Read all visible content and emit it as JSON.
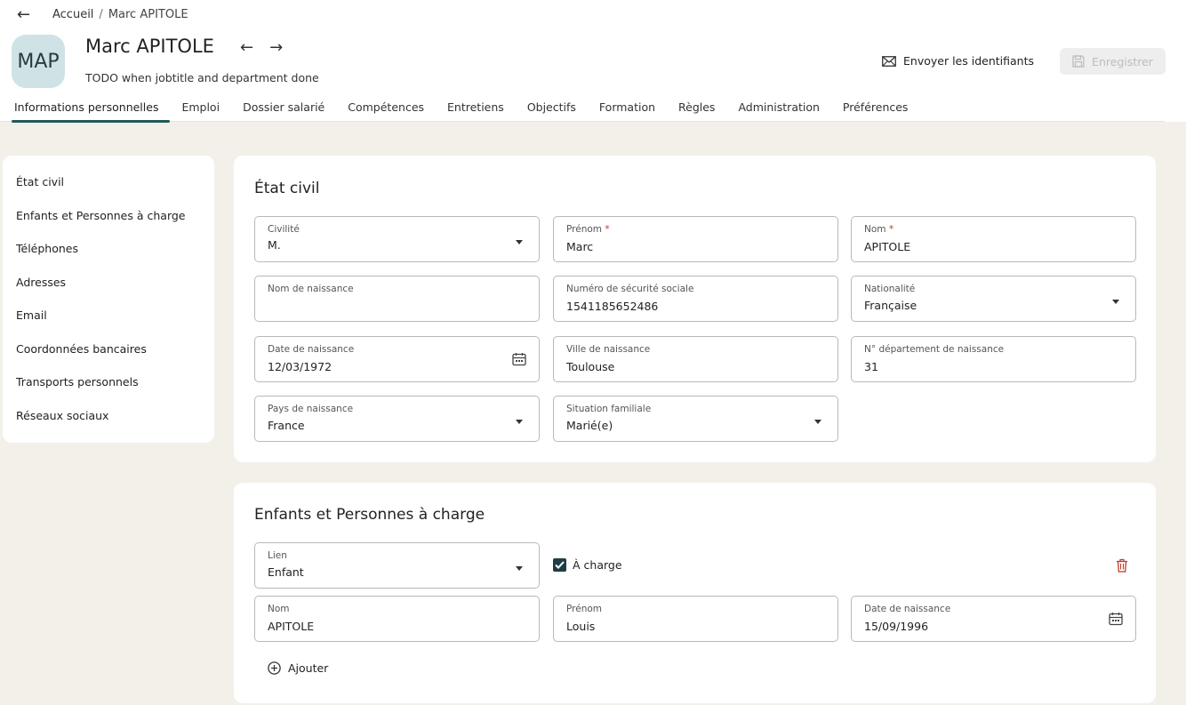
{
  "breadcrumb": {
    "back_icon": "←",
    "home": "Accueil",
    "separator": "/",
    "current": "Marc APITOLE"
  },
  "profile": {
    "initials": "MAP",
    "name": "Marc APITOLE",
    "subtitle": "TODO when jobtitle and department done",
    "prev_icon": "←",
    "next_icon": "→"
  },
  "actions": {
    "send_credentials": "Envoyer les identifiants",
    "save": "Enregistrer"
  },
  "tabs": [
    "Informations personnelles",
    "Emploi",
    "Dossier salarié",
    "Compétences",
    "Entretiens",
    "Objectifs",
    "Formation",
    "Règles",
    "Administration",
    "Préférences"
  ],
  "side_menu": [
    "État civil",
    "Enfants et Personnes à charge",
    "Téléphones",
    "Adresses",
    "Email",
    "Coordonnées bancaires",
    "Transports personnels",
    "Réseaux sociaux"
  ],
  "etat_civil": {
    "title": "État civil",
    "civilite": {
      "label": "Civilité",
      "value": "M."
    },
    "prenom": {
      "label": "Prénom",
      "required": "*",
      "value": "Marc"
    },
    "nom": {
      "label": "Nom",
      "required": "*",
      "value": "APITOLE"
    },
    "nom_naissance": {
      "label": "Nom de naissance",
      "value": ""
    },
    "secu": {
      "label": "Numéro de sécurité sociale",
      "value": "1541185652486"
    },
    "nationalite": {
      "label": "Nationalité",
      "value": "Française"
    },
    "date_naissance": {
      "label": "Date de naissance",
      "value": "12/03/1972"
    },
    "ville_naissance": {
      "label": "Ville de naissance",
      "value": "Toulouse"
    },
    "dept_naissance": {
      "label": "N° département de naissance",
      "value": "31"
    },
    "pays_naissance": {
      "label": "Pays de naissance",
      "value": "France"
    },
    "situation": {
      "label": "Situation familiale",
      "value": "Marié(e)"
    }
  },
  "enfants": {
    "title": "Enfants et Personnes à charge",
    "lien": {
      "label": "Lien",
      "value": "Enfant"
    },
    "a_charge": "À charge",
    "nom": {
      "label": "Nom",
      "value": "APITOLE"
    },
    "prenom": {
      "label": "Prénom",
      "value": "Louis"
    },
    "date_naissance": {
      "label": "Date de naissance",
      "value": "15/09/1996"
    },
    "add_label": "Ajouter"
  },
  "colors": {
    "accent": "#1f5a5a",
    "avatar_bg": "#cfe3e6",
    "page_bg": "#f3f0ea",
    "danger": "#c0392b"
  }
}
